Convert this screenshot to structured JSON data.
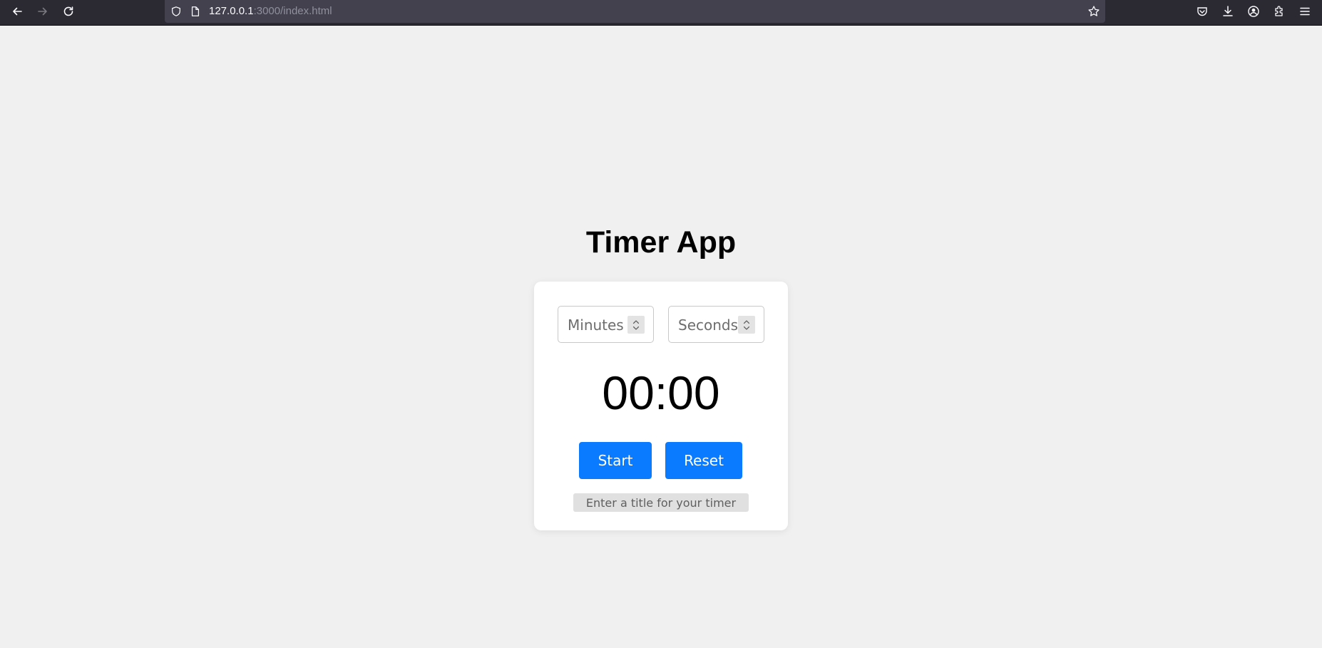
{
  "browser": {
    "url_host": "127.0.0.1",
    "url_rest": ":3000/index.html",
    "icons": [
      "back-arrow-icon",
      "forward-arrow-icon",
      "reload-icon",
      "shield-icon",
      "page-icon",
      "bookmark-star-icon",
      "pocket-icon",
      "download-icon",
      "account-icon",
      "extensions-icon",
      "menu-icon"
    ]
  },
  "app": {
    "title": "Timer App",
    "minutes_placeholder": "Minutes",
    "seconds_placeholder": "Seconds",
    "display": "00:00",
    "start_label": "Start",
    "reset_label": "Reset",
    "title_placeholder": "Enter a title for your timer"
  },
  "colors": {
    "accent": "#0a7bff",
    "background": "#f0f0f0",
    "card": "#ffffff"
  }
}
